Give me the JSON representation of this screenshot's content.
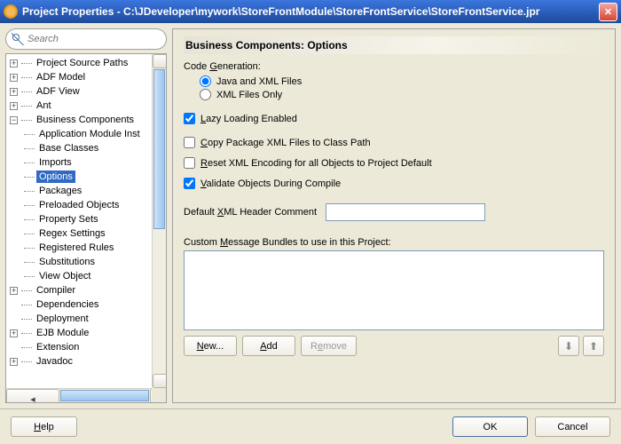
{
  "window": {
    "title": "Project Properties - C:\\JDeveloper\\mywork\\StoreFrontModule\\StoreFrontService\\StoreFrontService.jpr"
  },
  "search": {
    "placeholder": "Search"
  },
  "tree": {
    "items": [
      {
        "label": "Project Source Paths",
        "expandable": true,
        "level": 0
      },
      {
        "label": "ADF Model",
        "expandable": true,
        "level": 0
      },
      {
        "label": "ADF View",
        "expandable": true,
        "level": 0
      },
      {
        "label": "Ant",
        "expandable": true,
        "level": 0
      },
      {
        "label": "Business Components",
        "expandable": true,
        "expanded": true,
        "level": 0
      },
      {
        "label": "Application Module Inst",
        "level": 1
      },
      {
        "label": "Base Classes",
        "level": 1
      },
      {
        "label": "Imports",
        "level": 1
      },
      {
        "label": "Options",
        "level": 1,
        "selected": true
      },
      {
        "label": "Packages",
        "level": 1
      },
      {
        "label": "Preloaded Objects",
        "level": 1
      },
      {
        "label": "Property Sets",
        "level": 1
      },
      {
        "label": "Regex Settings",
        "level": 1
      },
      {
        "label": "Registered Rules",
        "level": 1
      },
      {
        "label": "Substitutions",
        "level": 1
      },
      {
        "label": "View Object",
        "level": 1
      },
      {
        "label": "Compiler",
        "expandable": true,
        "level": 0
      },
      {
        "label": "Dependencies",
        "level": 0
      },
      {
        "label": "Deployment",
        "level": 0
      },
      {
        "label": "EJB Module",
        "expandable": true,
        "level": 0
      },
      {
        "label": "Extension",
        "level": 0
      },
      {
        "label": "Javadoc",
        "expandable": true,
        "level": 0
      }
    ]
  },
  "panel": {
    "title": "Business Components: Options",
    "codegen_label": "Code Generation:",
    "radio_java_xml": "Java and XML Files",
    "radio_xml_only": "XML Files Only",
    "lazy_loading": "Lazy Loading Enabled",
    "copy_pkg": "Copy Package XML Files to Class Path",
    "reset_enc": "Reset XML Encoding for all Objects to Project Default",
    "validate": "Validate Objects During Compile",
    "xml_header_label": "Default XML Header Comment",
    "xml_header_value": "",
    "bundles_label": "Custom Message Bundles to use in this Project:",
    "buttons": {
      "new": "New...",
      "add": "Add",
      "remove": "Remove"
    }
  },
  "footer": {
    "help": "Help",
    "ok": "OK",
    "cancel": "Cancel"
  }
}
